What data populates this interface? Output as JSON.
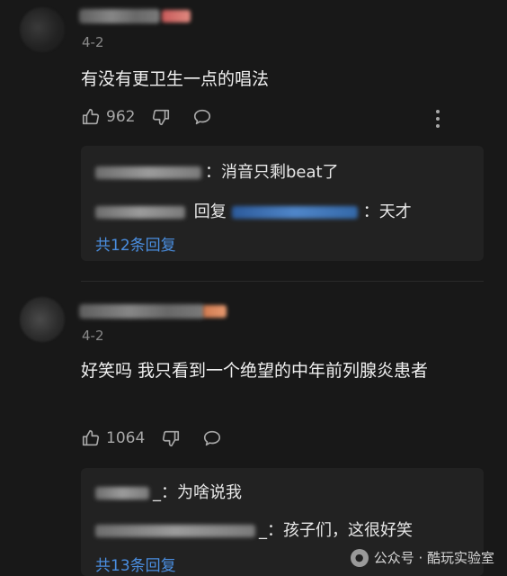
{
  "comments": [
    {
      "date": "4-2",
      "text": "有没有更卫生一点的唱法",
      "likes": "962",
      "replies": [
        {
          "sep": "：",
          "text": "消音只剩beat了"
        },
        {
          "reply_word": "回复",
          "sep": "：",
          "text": "天才"
        }
      ],
      "more_replies": "共12条回复"
    },
    {
      "date": "4-2",
      "text": "好笑吗 我只看到一个绝望的中年前列腺炎患者",
      "likes": "1064",
      "replies": [
        {
          "sep": "_：",
          "text": "为啥说我"
        },
        {
          "sep": "_：",
          "text": "孩子们，这很好笑"
        }
      ],
      "more_replies": "共13条回复"
    }
  ],
  "icons": {
    "like": "thumbs-up-icon",
    "dislike": "thumbs-down-icon",
    "reply": "comment-bubble-icon",
    "more": "more-vertical-icon"
  },
  "colors": {
    "background": "#181818",
    "link": "#4a8ee0",
    "reply_card": "#222222"
  },
  "watermark": {
    "text": "公众号 · 酷玩实验室"
  }
}
